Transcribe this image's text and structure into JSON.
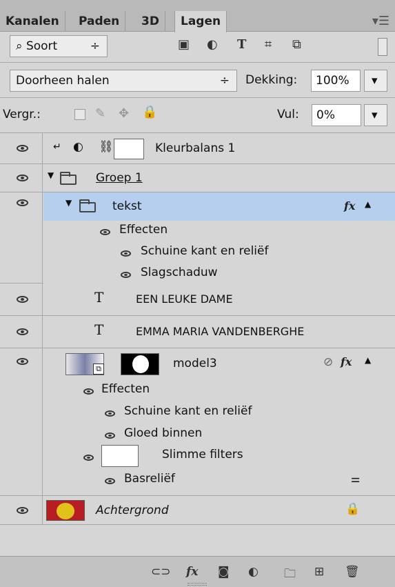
{
  "tabs": [
    "Kanalen",
    "Paden",
    "3D",
    "Lagen"
  ],
  "filter": {
    "label": "Soort"
  },
  "blend_mode": "Doorheen halen",
  "opacity": {
    "label": "Dekking:",
    "value": "100%"
  },
  "lock": {
    "label": "Vergr.:"
  },
  "fill": {
    "label": "Vul:",
    "value": "0%"
  },
  "layers": {
    "kleurbalans": "Kleurbalans 1",
    "groep": "Groep 1",
    "tekst": "tekst",
    "tekst_effects": "Effecten",
    "tekst_effect_1": "Schuine kant en reliëf",
    "tekst_effect_2": "Slagschaduw",
    "text1": "EEN LEUKE DAME",
    "text2": "EMMA MARIA VANDENBERGHE",
    "model": "model3",
    "model_effects": "Effecten",
    "model_effect_1": "Schuine kant en reliëf",
    "model_effect_2": "Gloed binnen",
    "smart_filters": "Slimme filters",
    "smart_filter_1": "Basreliëf",
    "background": "Achtergrond"
  },
  "colors": {
    "selected_row": "#b6cfee",
    "panel": "#d6d6d6"
  }
}
